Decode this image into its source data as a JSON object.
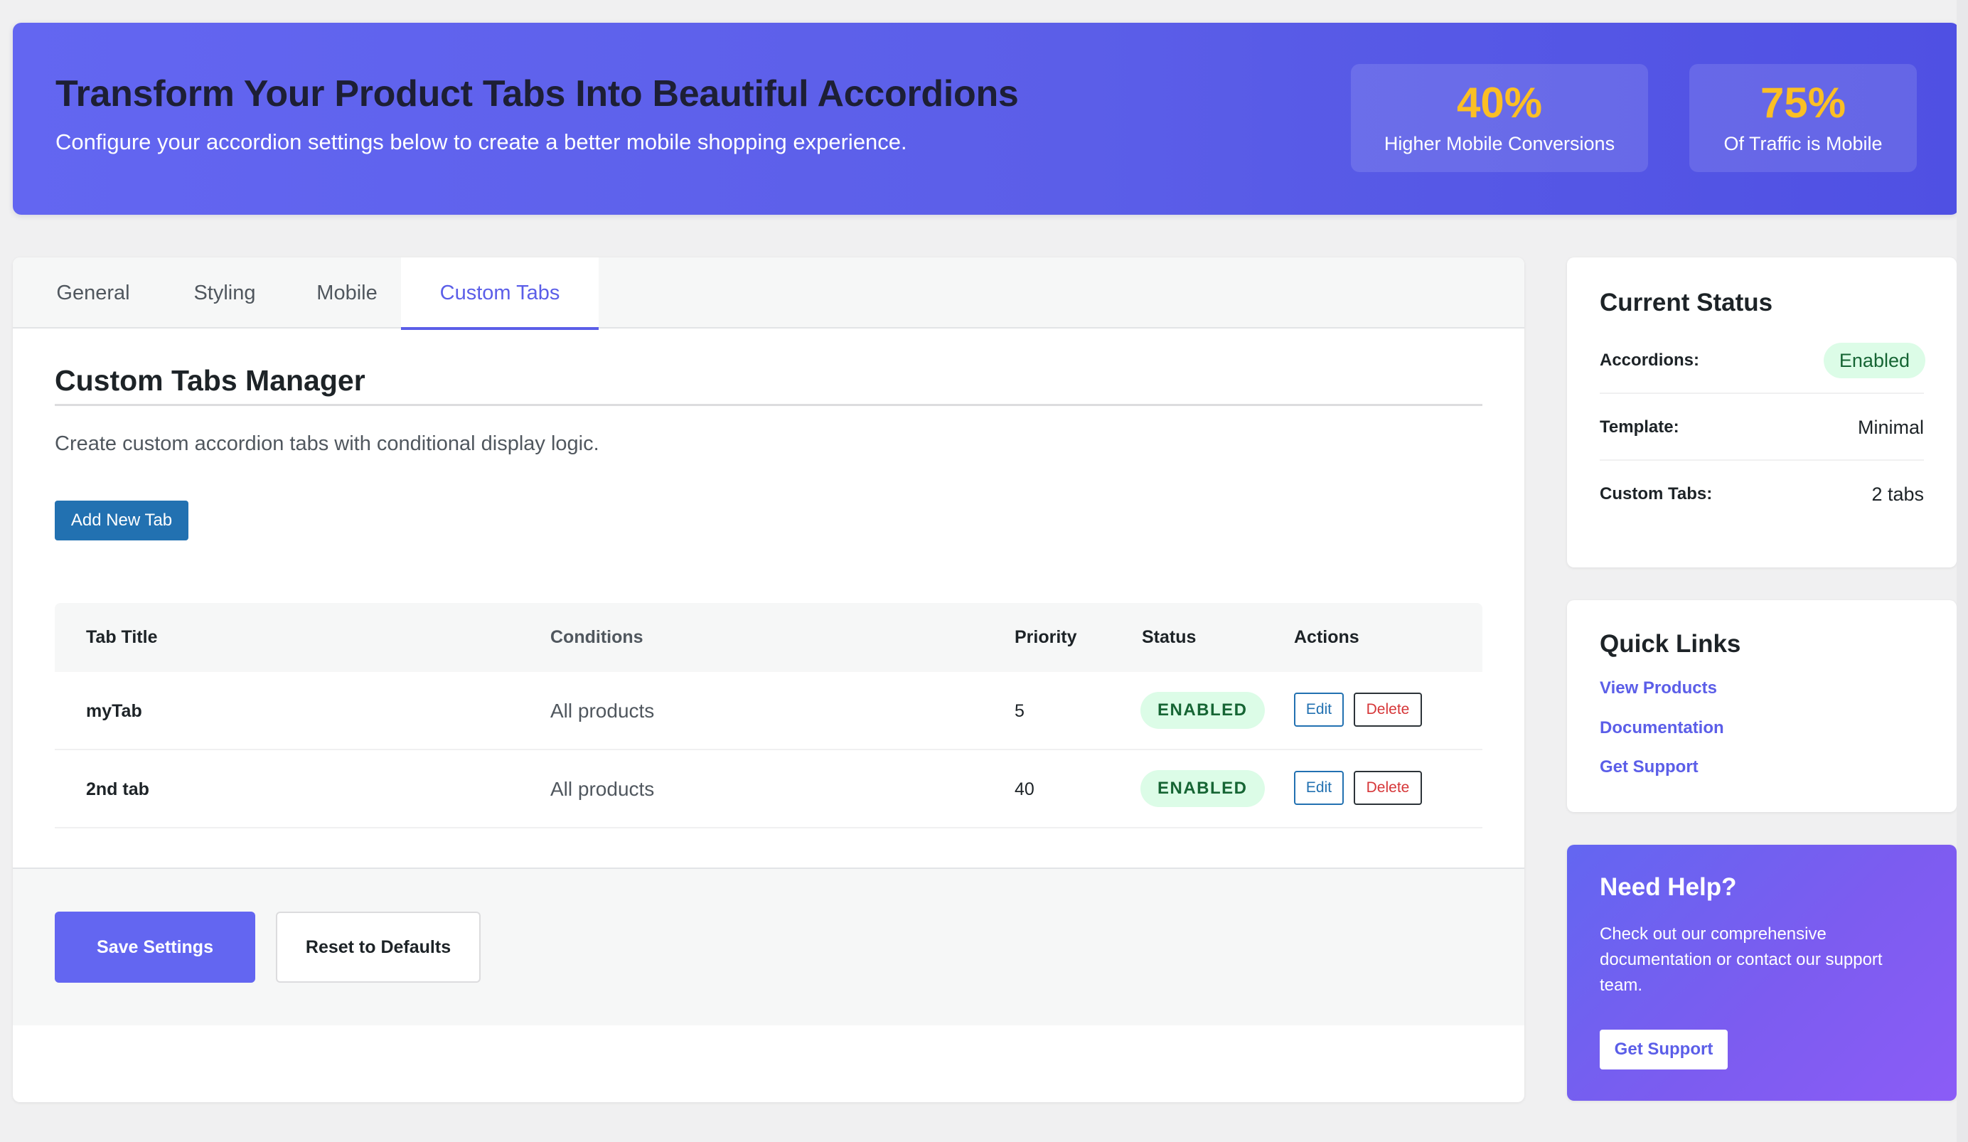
{
  "hero": {
    "title": "Transform Your Product Tabs Into Beautiful Accordions",
    "subtitle": "Configure your accordion settings below to create a better mobile shopping experience.",
    "stats": [
      {
        "value": "40%",
        "label": "Higher Mobile Conversions"
      },
      {
        "value": "75%",
        "label": "Of Traffic is Mobile"
      }
    ]
  },
  "tabs": [
    {
      "label": "General"
    },
    {
      "label": "Styling"
    },
    {
      "label": "Mobile"
    },
    {
      "label": "Custom Tabs",
      "active": true
    }
  ],
  "manager": {
    "title": "Custom Tabs Manager",
    "description": "Create custom accordion tabs with conditional display logic.",
    "add_button": "Add New Tab",
    "columns": [
      "Tab Title",
      "Conditions",
      "Priority",
      "Status",
      "Actions"
    ],
    "rows": [
      {
        "title": "myTab",
        "conditions": "All products",
        "priority": "5",
        "status": "ENABLED",
        "edit": "Edit",
        "delete": "Delete"
      },
      {
        "title": "2nd tab",
        "conditions": "All products",
        "priority": "40",
        "status": "ENABLED",
        "edit": "Edit",
        "delete": "Delete"
      }
    ]
  },
  "actions": {
    "save": "Save Settings",
    "reset": "Reset to Defaults"
  },
  "current_status": {
    "title": "Current Status",
    "rows": [
      {
        "label": "Accordions:",
        "value": "Enabled"
      },
      {
        "label": "Template:",
        "value": "Minimal"
      },
      {
        "label": "Custom Tabs:",
        "value": "2 tabs"
      }
    ]
  },
  "quick_links": {
    "title": "Quick Links",
    "links": [
      "View Products",
      "Documentation",
      "Get Support"
    ]
  },
  "help": {
    "title": "Need Help?",
    "text": "Check out our comprehensive documentation or contact our support team.",
    "button": "Get Support"
  },
  "colors": {
    "accent": "#6366f1",
    "stat_highlight": "#fbbf24",
    "enabled_bg": "#dcfce7",
    "enabled_text": "#166534",
    "wp_blue": "#2271b1",
    "delete_red": "#d63638"
  }
}
